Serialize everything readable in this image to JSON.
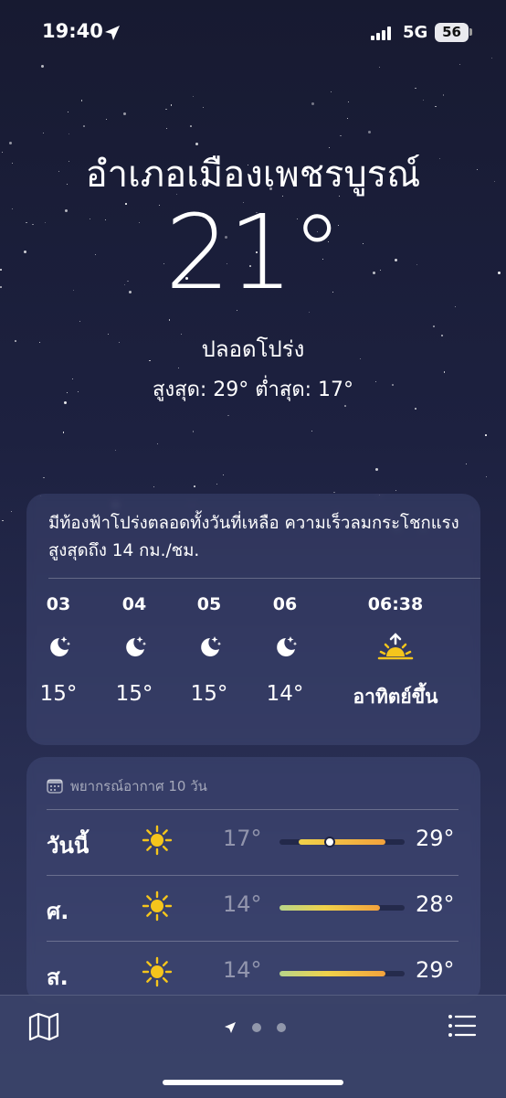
{
  "status_bar": {
    "time": "19:40",
    "network": "5G",
    "battery": "56"
  },
  "header": {
    "location": "อำเภอเมืองเพชรบูรณ์",
    "temperature": "21°",
    "condition": "ปลอดโปร่ง",
    "high_low": "สูงสุด: 29°  ต่ำสุด: 17°"
  },
  "hourly": {
    "summary": "มีท้องฟ้าโปร่งตลอดทั้งวันที่เหลือ ความเร็วลมกระโชกแรงสูงสุดถึง 14 กม./ชม.",
    "items": [
      {
        "time": "03",
        "icon": "moon-stars-icon",
        "temp": "15°"
      },
      {
        "time": "04",
        "icon": "moon-stars-icon",
        "temp": "15°"
      },
      {
        "time": "05",
        "icon": "moon-stars-icon",
        "temp": "15°"
      },
      {
        "time": "06",
        "icon": "moon-stars-icon",
        "temp": "14°"
      },
      {
        "time": "06:38",
        "icon": "sunrise-icon",
        "temp": "อาทิตย์ขึ้น"
      }
    ]
  },
  "daily": {
    "title": "พยากรณ์อากาศ 10 วัน",
    "days": [
      {
        "day": "วันนี้",
        "icon": "sun-icon",
        "low": "17°",
        "high": "29°",
        "range_start": 0.15,
        "range_end": 0.85,
        "current": 0.4
      },
      {
        "day": "ศ.",
        "icon": "sun-icon",
        "low": "14°",
        "high": "28°",
        "range_start": 0.0,
        "range_end": 0.8
      },
      {
        "day": "ส.",
        "icon": "sun-icon",
        "low": "14°",
        "high": "29°",
        "range_start": 0.0,
        "range_end": 0.85
      }
    ]
  },
  "colors": {
    "sun": "#f5c51c",
    "bar_cool": "#b8d68a",
    "bar_warm": "#f3a23c",
    "bar_yellow": "#f0d24a"
  },
  "pager": {
    "pages": 3,
    "current": 0
  }
}
